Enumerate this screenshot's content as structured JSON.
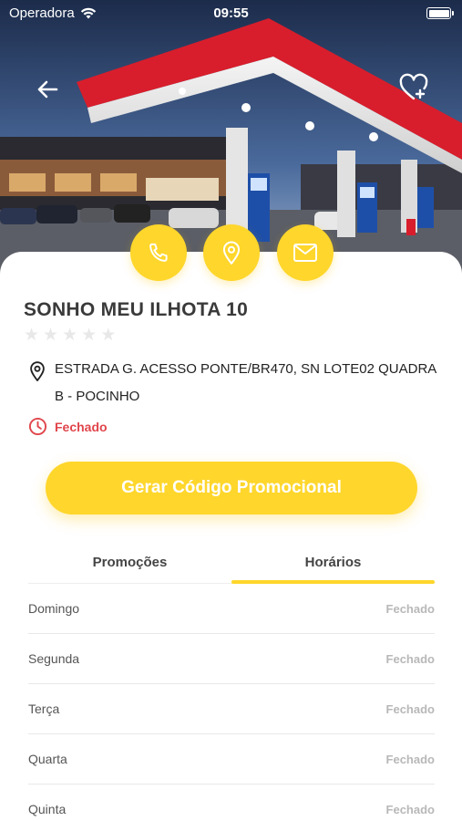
{
  "status_bar": {
    "carrier": "Operadora",
    "time": "09:55"
  },
  "icons": {
    "back": "arrow-left-icon",
    "favorite": "heart-plus-icon",
    "phone": "phone-icon",
    "location": "location-pin-icon",
    "mail": "mail-icon",
    "address_pin": "location-pin-icon",
    "clock": "clock-icon"
  },
  "station": {
    "name": "SONHO MEU ILHOTA 10",
    "rating_stars": 0,
    "rating_max": 5,
    "address": "ESTRADA G. ACESSO PONTE/BR470, SN LOTE02 QUADRA B - POCINHO",
    "status": "Fechado"
  },
  "promo_button": {
    "label": "Gerar Código Promocional"
  },
  "tabs": [
    {
      "label": "Promoções",
      "active": false
    },
    {
      "label": "Horários",
      "active": true
    }
  ],
  "hours": [
    {
      "day": "Domingo",
      "value": "Fechado"
    },
    {
      "day": "Segunda",
      "value": "Fechado"
    },
    {
      "day": "Terça",
      "value": "Fechado"
    },
    {
      "day": "Quarta",
      "value": "Fechado"
    },
    {
      "day": "Quinta",
      "value": "Fechado"
    }
  ],
  "colors": {
    "accent": "#ffd62b",
    "closed_red": "#e0464c"
  }
}
